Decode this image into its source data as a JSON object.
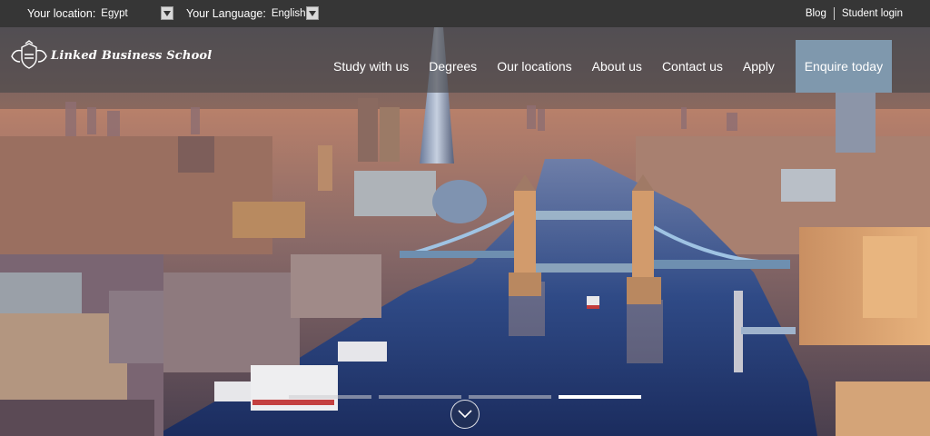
{
  "topbar": {
    "location_label": "Your location:",
    "location_value": "Egypt",
    "language_label": "Your Language:",
    "language_value": "English",
    "links": [
      "Blog",
      "Student login"
    ]
  },
  "brand": {
    "name": "Linked Business School"
  },
  "nav": {
    "items": [
      "Study with us",
      "Degrees",
      "Our locations",
      "About us",
      "Contact us",
      "Apply"
    ],
    "cta": "Enquire today"
  },
  "carousel": {
    "slide_count": 4,
    "active_slide": 4
  },
  "colors": {
    "topbar_bg": "#363636",
    "cta_bg": "#7f98ad",
    "text": "#ffffff"
  },
  "icons": {
    "dropdown": "chevron-down-icon",
    "scroll": "chevron-down-icon"
  }
}
